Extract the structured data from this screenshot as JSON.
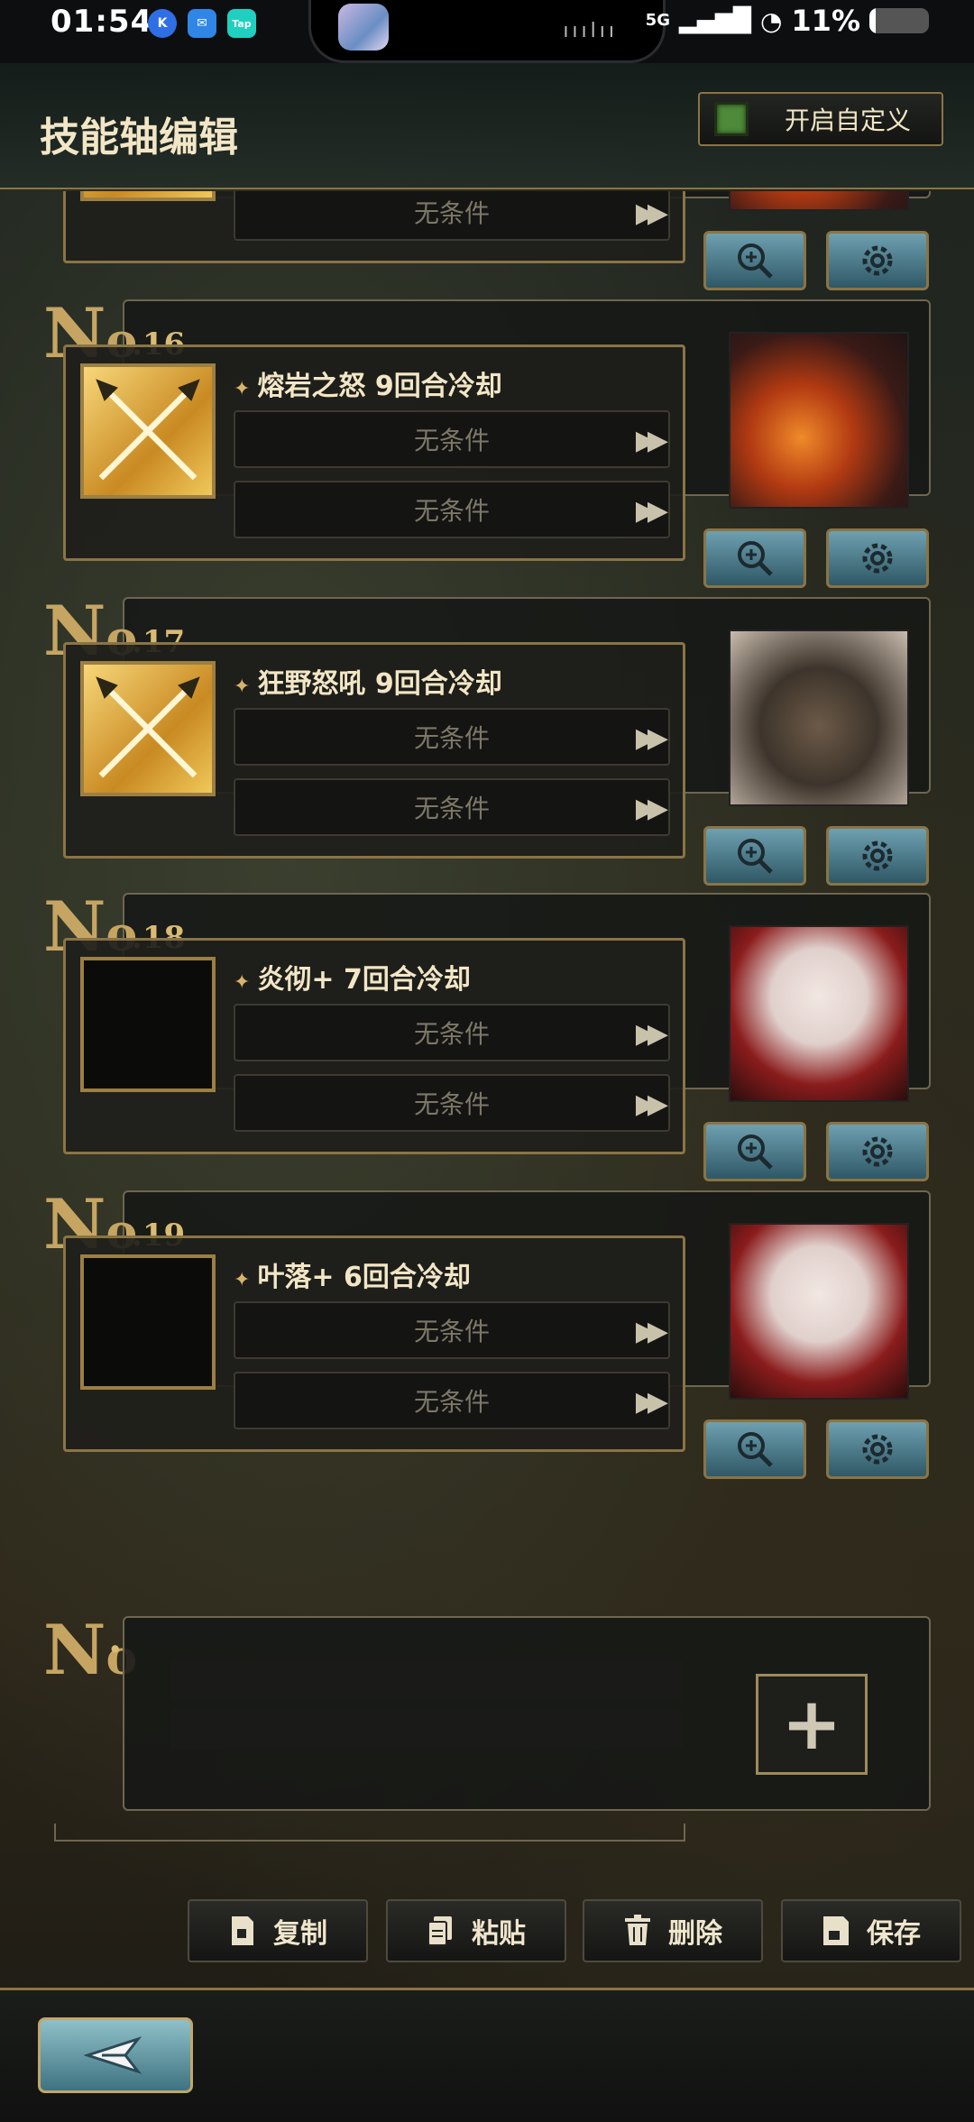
{
  "status_bar": {
    "time": "01:54",
    "apps": [
      "K",
      "msg",
      "Tap"
    ],
    "network": "5G",
    "battery_percent": "11%",
    "battery_level": 0.11,
    "island_indicator": "ııılıı"
  },
  "header": {
    "title": "技能轴编辑",
    "custom_toggle_label": "开启自定义"
  },
  "entries": [
    {
      "number": "",
      "skill": "",
      "cond1": "无条件",
      "cond2": "无条件",
      "icon": "crossed-swords-icon",
      "portrait": "dragon"
    },
    {
      "number": ".16",
      "skill": "熔岩之怒 9回合冷却",
      "cond1": "无条件",
      "cond2": "无条件",
      "icon": "crossed-swords-icon",
      "portrait": "dragon"
    },
    {
      "number": ".17",
      "skill": "狂野怒吼 9回合冷却",
      "cond1": "无条件",
      "cond2": "无条件",
      "icon": "crossed-swords-icon",
      "portrait": "boar"
    },
    {
      "number": ".18",
      "skill": "炎彻+ 7回合冷却",
      "cond1": "无条件",
      "cond2": "无条件",
      "icon": "",
      "portrait": "girl"
    },
    {
      "number": ".19",
      "skill": "叶落+ 6回合冷却",
      "cond1": "无条件",
      "cond2": "无条件",
      "icon": "",
      "portrait": "girl"
    }
  ],
  "no_prefix": "N",
  "no_suffix": "o",
  "add_slot": {
    "number": ".",
    "plus": "+"
  },
  "toolbar": {
    "copy": "复制",
    "paste": "粘贴",
    "delete": "删除",
    "save": "保存"
  },
  "colors": {
    "accent_gold": "#8a7446",
    "toggle_green": "#4e8a3a",
    "button_teal": "#3e7381"
  }
}
